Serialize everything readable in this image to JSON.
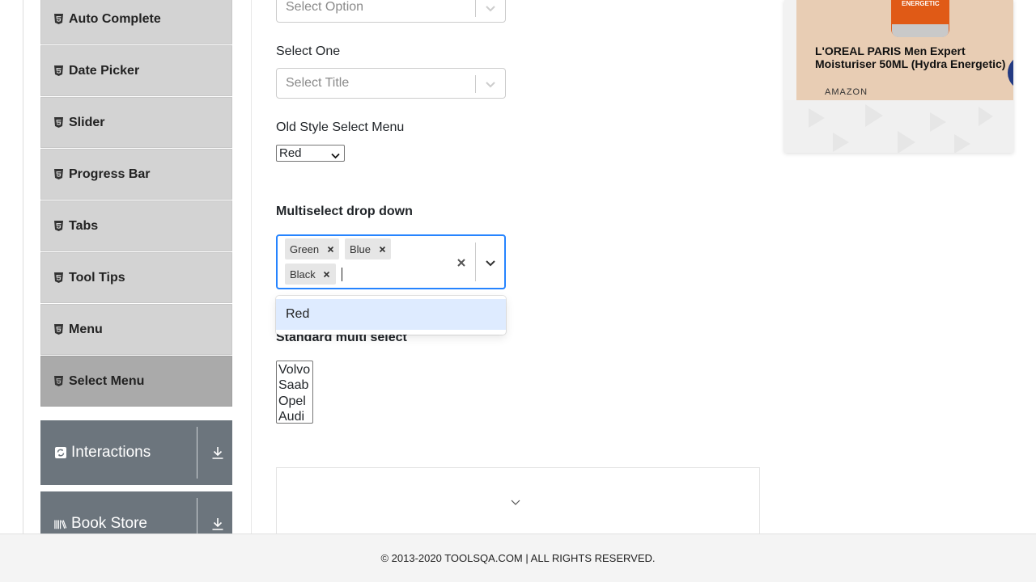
{
  "sidebar": {
    "items": [
      {
        "label": "Auto Complete",
        "active": false
      },
      {
        "label": "Date Picker",
        "active": false
      },
      {
        "label": "Slider",
        "active": false
      },
      {
        "label": "Progress Bar",
        "active": false
      },
      {
        "label": "Tabs",
        "active": false
      },
      {
        "label": "Tool Tips",
        "active": false
      },
      {
        "label": "Menu",
        "active": false
      },
      {
        "label": "Select Menu",
        "active": true
      }
    ],
    "groups": [
      {
        "label": "Interactions"
      },
      {
        "label": "Book Store"
      }
    ]
  },
  "main": {
    "select_value": {
      "placeholder": "Select Option"
    },
    "select_one": {
      "label": "Select One",
      "placeholder": "Select Title"
    },
    "old_style": {
      "label": "Old Style Select Menu",
      "value": "Red"
    },
    "multiselect": {
      "label": "Multiselect drop down",
      "chips": [
        "Green",
        "Blue",
        "Black"
      ],
      "menu_options": [
        "Red"
      ]
    },
    "standard_multi": {
      "label": "Standard multi select",
      "options": [
        "Volvo",
        "Saab",
        "Opel",
        "Audi"
      ]
    }
  },
  "ad": {
    "product_title": "L'OREAL PARIS Men Expert Moisturiser 50ML (Hydra Energetic)",
    "brand": "AMAZON",
    "product_label": "ENERGETIC"
  },
  "footer": {
    "text": "© 2013-2020 TOOLSQA.COM | ALL RIGHTS RESERVED."
  },
  "colors": {
    "accent": "#2684ff",
    "sidebar_item": "#d3d3d3",
    "sidebar_active": "#aaaaaa",
    "group_header": "#6c757d",
    "option_focus": "#deebff"
  }
}
